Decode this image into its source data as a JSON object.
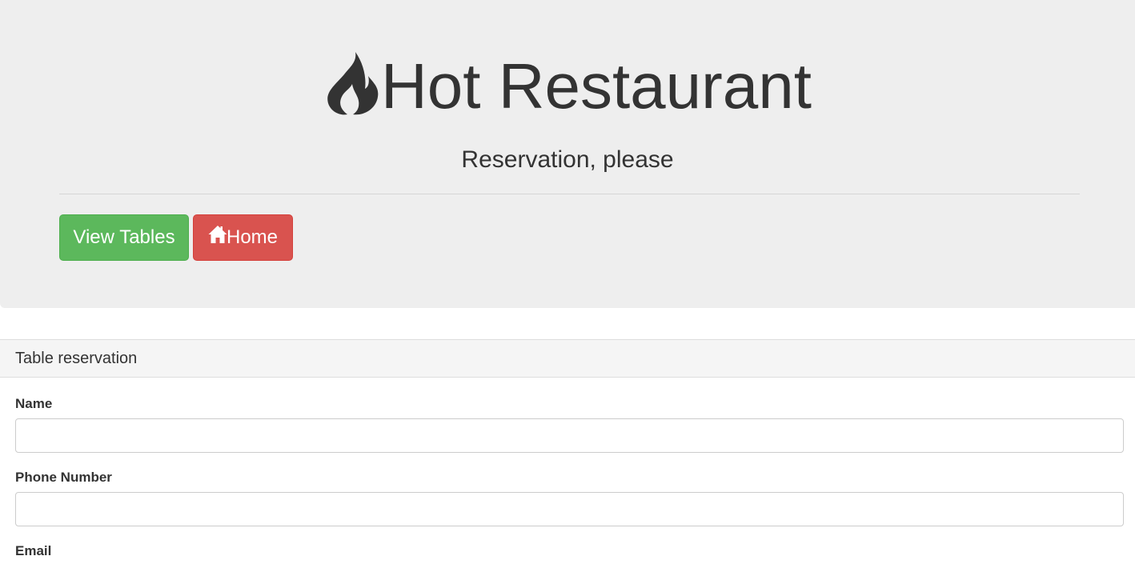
{
  "header": {
    "title": "Hot Restaurant",
    "subtitle": "Reservation, please",
    "icon": "fire-icon"
  },
  "nav": {
    "view_tables_label": "View Tables",
    "home_label": "Home",
    "home_icon": "home-icon",
    "colors": {
      "success": "#5cb85c",
      "danger": "#d9534f"
    }
  },
  "form": {
    "panel_title": "Table reservation",
    "fields": [
      {
        "label": "Name",
        "value": "",
        "placeholder": ""
      },
      {
        "label": "Phone Number",
        "value": "",
        "placeholder": ""
      },
      {
        "label": "Email"
      }
    ]
  }
}
